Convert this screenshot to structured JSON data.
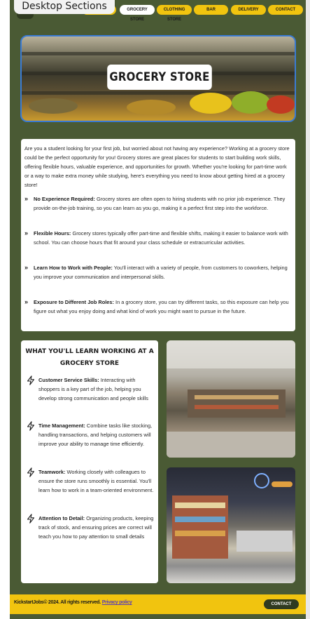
{
  "frame_label": "Desktop Sections",
  "nav": {
    "items": [
      {
        "label": "",
        "name": "nav-home"
      },
      {
        "label": "Grocery Store",
        "name": "nav-grocery-store"
      },
      {
        "label": "Clothing Store",
        "name": "nav-clothing-store"
      },
      {
        "label": "Bar",
        "name": "nav-bar"
      },
      {
        "label": "Delivery",
        "name": "nav-delivery"
      },
      {
        "label": "Contact",
        "name": "nav-contact"
      }
    ],
    "active": "Grocery Store"
  },
  "hero": {
    "title": "GROCERY STORE"
  },
  "intro": {
    "lead": "Are you a student looking for your first job, but worried about not having any experience? Working at a grocery store could be the perfect opportunity for you! Grocery stores are great places for students to start building work skills, offering flexible hours, valuable experience, and opportunities for growth. Whether you're looking for part-time work or a way to make extra money while studying, here's everything you need to know about getting hired at a grocery store!",
    "items": [
      {
        "title": "No Experience Required:",
        "text": " Grocery stores are often open to hiring students with no prior job experience. They provide on-the-job training, so you can learn as you go, making it a perfect first step into the workforce."
      },
      {
        "title": "Flexible Hours:",
        "text": " Grocery stores typically offer part-time and flexible shifts, making it easier to balance work with school. You can choose hours that fit around your class schedule or extracurricular activities."
      },
      {
        "title": "Learn How to Work with People:",
        "text": " You'll interact with a variety of people, from customers to coworkers, helping you improve your communication and interpersonal skills."
      },
      {
        "title": "Exposure to Different Job Roles:",
        "text": " In a grocery store, you can try different tasks, so this exposure can help you figure out what you enjoy doing and what kind of work you might want to pursue in the future."
      }
    ]
  },
  "learn": {
    "title": "WHAT YOU'LL LEARN WORKING AT A GROCERY STORE",
    "items": [
      {
        "title": "Customer Service Skills:",
        "text": " Interacting with shoppers is a key part of the job, helping you develop strong communication and people skills"
      },
      {
        "title": "Time Management:",
        "text": " Combine tasks like stocking, handling transactions, and helping customers will improve your ability to manage time efficiently."
      },
      {
        "title": "Teamwork:",
        "text": " Working closely with colleagues to ensure the store runs smoothly is essential. You'll learn how to work in a team-oriented environment."
      },
      {
        "title": "Attention to Detail:",
        "text": " Organizing products, keeping track of stock, and ensuring prices are correct will teach you how to pay attention to small details"
      }
    ]
  },
  "footer": {
    "copyright": "KickstartJobs© 2024. All rights reserved.",
    "privacy": "Privacy policy",
    "contact": "Contact"
  },
  "colors": {
    "background": "#4a5a34",
    "accent": "#f1c40f",
    "card": "#ffffff",
    "hero_border": "#3a7bd5"
  }
}
